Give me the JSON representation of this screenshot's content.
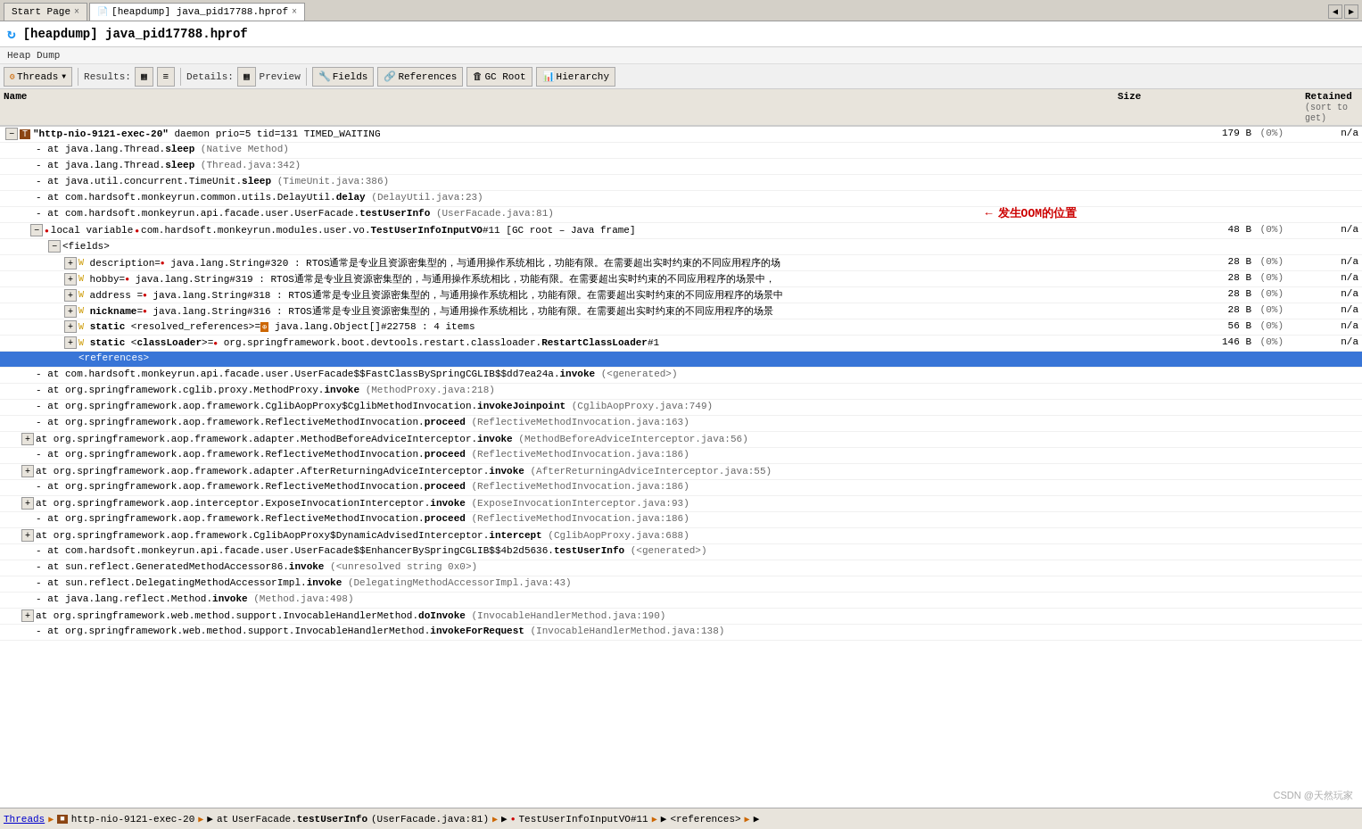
{
  "tabs": [
    {
      "label": "Start Page",
      "active": false,
      "closable": true
    },
    {
      "label": "[heapdump] java_pid17788.hprof",
      "active": true,
      "closable": true
    }
  ],
  "title": "[heapdump] java_pid17788.hprof",
  "breadcrumb": "Heap Dump",
  "toolbar": {
    "threads_label": "Threads",
    "results_label": "Results:",
    "details_label": "Details:",
    "preview_label": "Preview",
    "fields_label": "Fields",
    "references_label": "References",
    "gc_root_label": "GC Root",
    "hierarchy_label": "Hierarchy"
  },
  "table": {
    "col_name": "Name",
    "col_size": "Size",
    "col_retained": "Retained",
    "col_sort": "(sort to get)"
  },
  "annotation": "发生OOM的位置",
  "status_bar": {
    "threads": "Threads",
    "sep1": ">",
    "thread": "http-nio-9121-exec-20",
    "sep2": ">",
    "at": "at",
    "method": "UserFacade.testUserInfo",
    "location": "(UserFacade.java:81)",
    "sep3": ">",
    "var": "TestUserInfoInputVO#11",
    "sep4": ">",
    "ref": "<references>"
  },
  "watermark": "CSDN @天然玩家"
}
